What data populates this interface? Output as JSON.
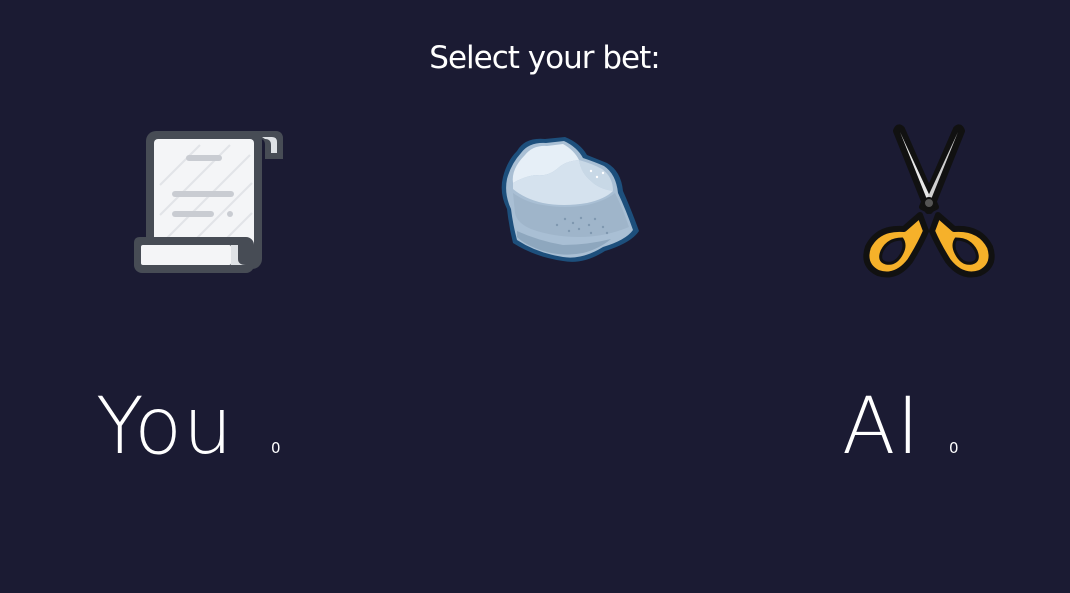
{
  "prompt": "Select your bet:",
  "choices": [
    {
      "id": "paper",
      "icon": "paper-scroll-icon"
    },
    {
      "id": "rock",
      "icon": "rock-icon"
    },
    {
      "id": "scissors",
      "icon": "scissors-icon"
    }
  ],
  "players": {
    "you": {
      "label": "You",
      "score": "0"
    },
    "ai": {
      "label": "AI",
      "score": "0"
    }
  },
  "colors": {
    "background": "#1b1b33",
    "text": "#ffffff",
    "scissors_handle": "#f6b12a",
    "rock_outline": "#1d4f7c",
    "paper_outline": "#474c55"
  }
}
